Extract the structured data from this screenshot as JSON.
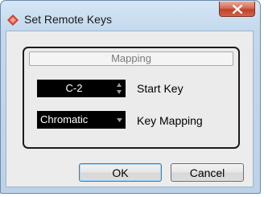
{
  "window": {
    "title": "Set Remote Keys",
    "close_glyph": "✕"
  },
  "mapping": {
    "header": "Mapping",
    "start_key_value": "C-2",
    "start_key_label": "Start Key",
    "key_mapping_value": "Chromatic",
    "key_mapping_label": "Key Mapping"
  },
  "buttons": {
    "ok": "OK",
    "cancel": "Cancel"
  },
  "icons": {
    "app": "cubase-app-icon",
    "close": "close-icon",
    "spinner": "spinner-arrows-icon",
    "dropdown": "chevron-down-icon"
  },
  "colors": {
    "field_bg": "#000000",
    "field_text": "#ffffff",
    "close_red": "#c2402a",
    "app_icon_red": "#d2412b"
  }
}
